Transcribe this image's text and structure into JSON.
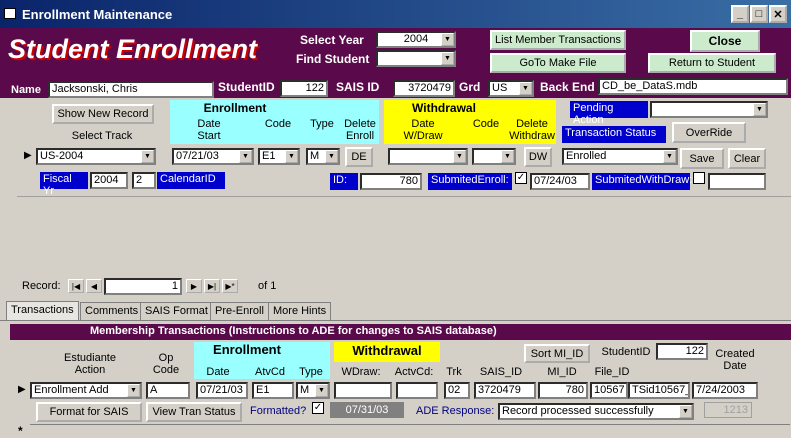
{
  "window": {
    "title": "Enrollment Maintenance"
  },
  "header": {
    "title": "Student Enrollment",
    "select_year_label": "Select Year",
    "select_year_value": "2004",
    "find_student_label": "Find Student",
    "find_student_value": "",
    "list_member_transactions": "List Member Transactions",
    "goto_make_file": "GoTo Make File",
    "close": "Close",
    "return_to_student": "Return to Student"
  },
  "info": {
    "name_label": "Name",
    "name_value": "Jacksonski, Chris",
    "studentid_label": "StudentID",
    "studentid_value": "122",
    "sais_label": "SAIS ID",
    "sais_value": "3720479",
    "grd_label": "Grd",
    "grd_value": "US",
    "backend_label": "Back End",
    "backend_value": "CD_be_DataS.mdb"
  },
  "enroll": {
    "show_new_record": "Show New Record",
    "select_track": "Select Track",
    "enrollment_header": "Enrollment",
    "date_start": "Date\nStart",
    "code": "Code",
    "type": "Type",
    "delete_enroll": "Delete\nEnroll",
    "withdrawal_header": "Withdrawal",
    "date_wdraw": "Date\nW/Draw",
    "wcode": "Code",
    "delete_withdraw": "Delete\nWithdraw",
    "pending_action": "Pending Action",
    "transaction_status": "Transaction Status",
    "override": "OverRide",
    "track_value": "US-2004",
    "date_value": "07/21/03",
    "code_value": "E1",
    "type_value": "M",
    "de": "DE",
    "dw": "DW",
    "status_value": "Enrolled",
    "save": "Save",
    "clear": "Clear",
    "fiscal_yr": "Fiscal Yr",
    "fiscal_value": "2004",
    "fiscal_num": "2",
    "calendar_id": "CalendarID",
    "id_label": "ID:",
    "id_value": "780",
    "submitted_enroll": "SubmitedEnroll:",
    "submitted_date": "07/24/03",
    "submitted_withdraw": "SubmitedWithDraw:"
  },
  "record_nav": {
    "label": "Record:",
    "current": "1",
    "of": "of  1"
  },
  "tabs": [
    "Transactions",
    "Comments",
    "SAIS Format",
    "Pre-Enroll",
    "More Hints"
  ],
  "transactions": {
    "title": "Membership Transactions (Instructions to ADE for changes to SAIS database)",
    "estudiante_action": "Estudiante\nAction",
    "op_code": "Op\nCode",
    "enrollment": "Enrollment",
    "date": "Date",
    "atvcd": "AtvCd",
    "type": "Type",
    "withdrawal": "Withdrawal",
    "wdraw": "WDraw:",
    "actvcd": "ActvCd:",
    "trk": "Trk",
    "sais_id": "SAIS_ID",
    "mi_id": "MI_ID",
    "file_id": "File_ID",
    "sort_mi_id": "Sort MI_ID",
    "studentid_label": "StudentID",
    "studentid_value": "122",
    "created_date": "Created\nDate",
    "row": {
      "action": "Enrollment Add",
      "op": "A",
      "date": "07/21/03",
      "atvcd": "E1",
      "type": "M",
      "trk": "02",
      "sais": "3720479",
      "mi": "780",
      "file": "10567",
      "tsid": "TSid10567_",
      "created": "7/24/2003"
    },
    "format_for_sais": "Format for SAIS",
    "view_tran_status": "View Tran Status",
    "formatted": "Formatted?",
    "formatted_date": "07/31/03",
    "ade_response_label": "ADE Response:",
    "ade_response_value": "Record processed successfully",
    "code_1213": "1213"
  }
}
